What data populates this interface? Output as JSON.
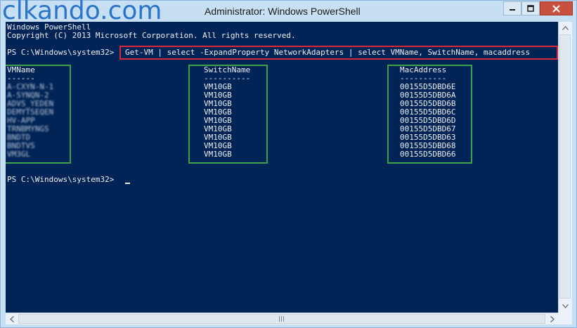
{
  "window": {
    "watermark": "clkando.com",
    "title": "Administrator: Windows PowerShell"
  },
  "console": {
    "banner1": "Windows PowerShell",
    "banner2": "Copyright (C) 2013 Microsoft Corporation. All rights reserved.",
    "prompt": "PS C:\\Windows\\system32>",
    "command": "Get-VM | select -ExpandProperty NetworkAdapters | select VMName, SwitchName, macaddress",
    "headers": {
      "vmname": "VMName",
      "switchname": "SwitchName",
      "macaddress": "MacAddress"
    },
    "underlines": {
      "vmname": "------",
      "switchname": "----------",
      "macaddress": "----------"
    },
    "rows": [
      {
        "vmname": "A-CXYN-N-1",
        "switch": "VM10GB",
        "mac": "00155D5DBD6E"
      },
      {
        "vmname": "A-SYNQN-2",
        "switch": "VM10GB",
        "mac": "00155D5DBD6A"
      },
      {
        "vmname": "ADVS_YEDEN",
        "switch": "VM10GB",
        "mac": "00155D5DBD6B"
      },
      {
        "vmname": "DEMYTSEQEN",
        "switch": "VM10GB",
        "mac": "00155D5DBD6C"
      },
      {
        "vmname": "HV-APP",
        "switch": "VM10GB",
        "mac": "00155D5DBD6D"
      },
      {
        "vmname": "TRNBMYNGS",
        "switch": "VM10GB",
        "mac": "00155D5DBD67"
      },
      {
        "vmname": "BNDTD",
        "switch": "VM10GB",
        "mac": "00155D5DBD63"
      },
      {
        "vmname": "BNDTVS",
        "switch": "VM10GB",
        "mac": "00155D5DBD68"
      },
      {
        "vmname": "VM3GL",
        "switch": "VM10GB",
        "mac": "00155D5DBD66"
      }
    ],
    "final_prompt": "PS C:\\Windows\\system32>"
  },
  "colors": {
    "console_bg": "#012456",
    "console_text": "#eeedf0",
    "command_highlight": "#d7283a",
    "column_highlight": "#3aa14a",
    "watermark": "#2a74c9"
  },
  "icons": {
    "minimize": "minimize-icon",
    "maximize": "maximize-icon",
    "close": "close-icon"
  }
}
